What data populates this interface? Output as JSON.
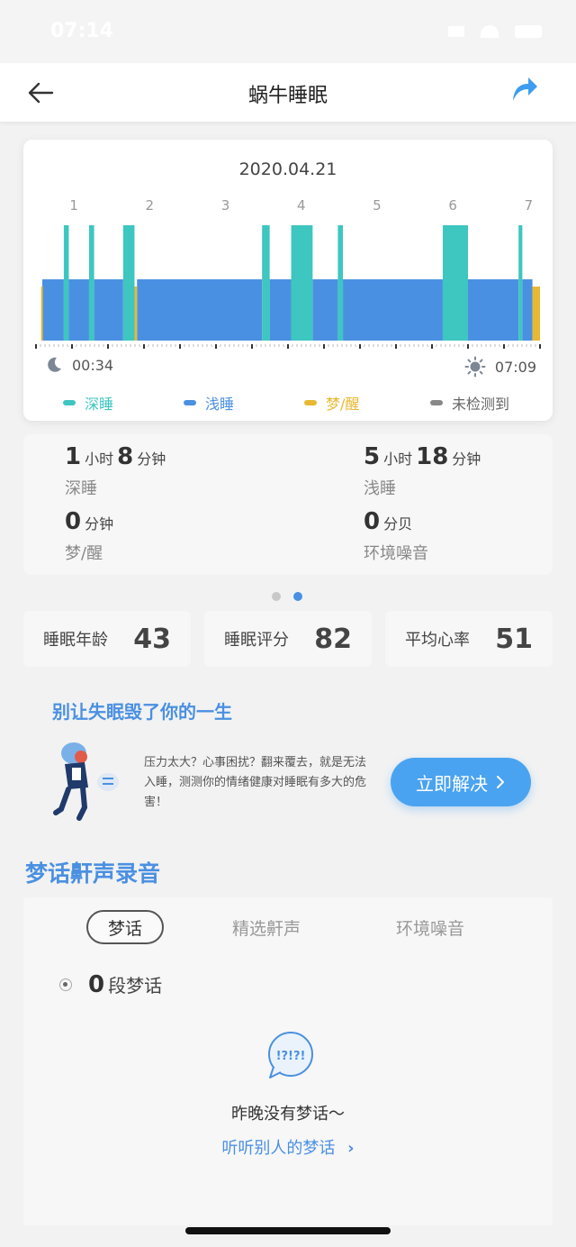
{
  "status_bar": {
    "time": "07:14"
  },
  "header": {
    "title": "蜗牛睡眠",
    "back_icon": "back-arrow-icon",
    "share_icon": "share-icon"
  },
  "chart": {
    "date": "2020.04.21",
    "hour_labels": [
      "1",
      "2",
      "3",
      "4",
      "5",
      "6",
      "7"
    ],
    "start_time": "00:34",
    "end_time": "07:09",
    "start_icon": "moon-icon",
    "end_icon": "sun-icon",
    "legend": [
      {
        "label": "深睡",
        "color": "#3ec6c0"
      },
      {
        "label": "浅睡",
        "color": "#4a90e2"
      },
      {
        "label": "梦/醒",
        "color": "#e8b832"
      },
      {
        "label": "未检测到",
        "color": "#888888"
      }
    ]
  },
  "chart_data": {
    "type": "bar",
    "x_range": [
      "00:34",
      "07:09"
    ],
    "x_tick_labels": [
      "1",
      "2",
      "3",
      "4",
      "5",
      "6",
      "7"
    ],
    "stage_colors": {
      "deep": "#3ec6c0",
      "light": "#4a90e2",
      "dream_awake": "#e8b832",
      "undetected": "#888888"
    },
    "segments": [
      {
        "stage": "dream_awake",
        "start": 0.567,
        "end": 0.583
      },
      {
        "stage": "light",
        "start": 0.583,
        "end": 0.867
      },
      {
        "stage": "deep",
        "start": 0.867,
        "end": 0.933
      },
      {
        "stage": "light",
        "start": 0.933,
        "end": 1.2
      },
      {
        "stage": "deep",
        "start": 1.2,
        "end": 1.267
      },
      {
        "stage": "light",
        "start": 1.267,
        "end": 1.65
      },
      {
        "stage": "deep",
        "start": 1.65,
        "end": 1.8
      },
      {
        "stage": "dream_awake",
        "start": 1.8,
        "end": 1.833
      },
      {
        "stage": "light",
        "start": 1.833,
        "end": 3.483
      },
      {
        "stage": "deep",
        "start": 3.483,
        "end": 3.583
      },
      {
        "stage": "light",
        "start": 3.583,
        "end": 3.867
      },
      {
        "stage": "deep",
        "start": 3.867,
        "end": 4.15
      },
      {
        "stage": "light",
        "start": 4.15,
        "end": 4.483
      },
      {
        "stage": "deep",
        "start": 4.483,
        "end": 4.55
      },
      {
        "stage": "light",
        "start": 4.55,
        "end": 5.867
      },
      {
        "stage": "deep",
        "start": 5.867,
        "end": 6.2
      },
      {
        "stage": "light",
        "start": 6.2,
        "end": 6.867
      },
      {
        "stage": "deep",
        "start": 6.867,
        "end": 6.917
      },
      {
        "stage": "light",
        "start": 6.917,
        "end": 7.05
      },
      {
        "stage": "dream_awake",
        "start": 7.05,
        "end": 7.15
      }
    ]
  },
  "stats": {
    "deep": {
      "hours": "1",
      "hour_unit": "小时",
      "minutes": "8",
      "minute_unit": "分钟",
      "label": "深睡"
    },
    "light": {
      "hours": "5",
      "hour_unit": "小时",
      "minutes": "18",
      "minute_unit": "分钟",
      "label": "浅睡"
    },
    "dream": {
      "value": "0",
      "unit": "分钟",
      "label": "梦/醒"
    },
    "noise": {
      "value": "0",
      "unit": "分贝",
      "label": "环境噪音"
    }
  },
  "metrics": [
    {
      "label": "睡眠年龄",
      "value": "43"
    },
    {
      "label": "睡眠评分",
      "value": "82"
    },
    {
      "label": "平均心率",
      "value": "51"
    }
  ],
  "promo": {
    "title": "别让失眠毁了你的一生",
    "text": "压力太大？心事困扰？翻来覆去，就是无法入睡，测测你的情绪健康对睡眠有多大的危害！",
    "button": "立即解决",
    "button_icon": "chevron-right-icon"
  },
  "recordings": {
    "title": "梦话鼾声录音",
    "tabs": [
      "梦话",
      "精选鼾声",
      "环境噪音"
    ],
    "count": "0",
    "count_unit": "段梦话",
    "bubble_text": "!?!?!",
    "empty_text": "昨晚没有梦话～",
    "link_text": "听听别人的梦话"
  }
}
